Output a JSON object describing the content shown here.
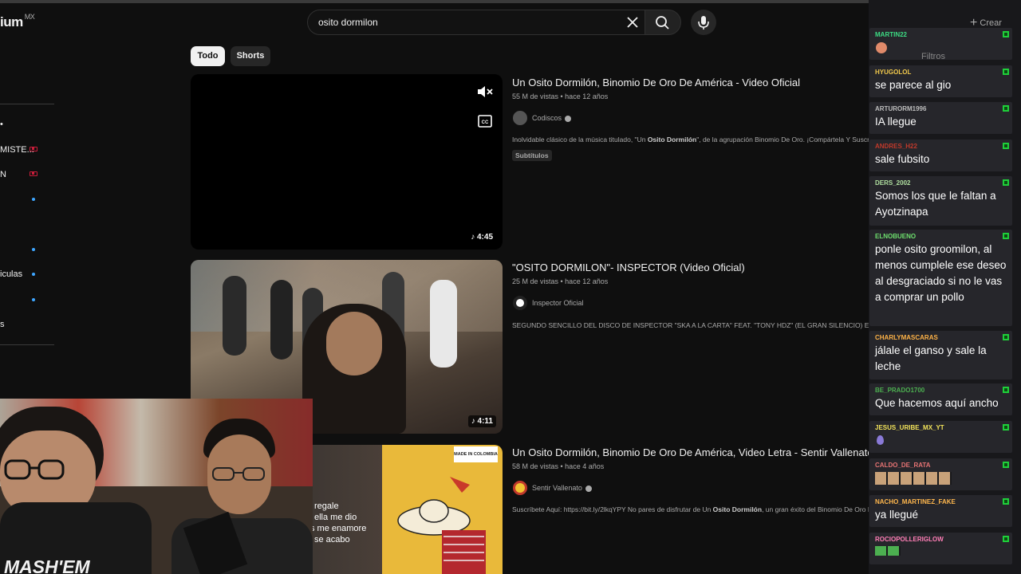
{
  "youtube": {
    "logo_text": "ium",
    "region": "MX",
    "search": {
      "query": "osito dormilon"
    },
    "chips": [
      "Todo",
      "Shorts"
    ],
    "sidebar_items": [
      "MISTE...",
      "N",
      "iculas",
      "s"
    ],
    "create_label": "Crear",
    "filters_label": "Filtros"
  },
  "results": [
    {
      "title": "Un Osito Dormilón, Binomio De Oro De América - Video Oficial",
      "meta": "55 M de vistas • hace 12 años",
      "channel": "Codiscos",
      "desc_prefix": "Inolvidable clásico de la música titulado, \"Un ",
      "desc_bold": "Osito Dormilón",
      "desc_suffix": "\", de la agrupación Binomio De Oro. ¡Compártela Y Suscríbete a ...",
      "badge": "Subtítulos",
      "duration": "4:45"
    },
    {
      "title": "\"OSITO DORMILON\"- INSPECTOR (Video Oficial)",
      "meta": "25 M de vistas • hace 12 años",
      "channel": "Inspector Oficial",
      "desc": "SEGUNDO SENCILLO DEL DISCO DE INSPECTOR \"SKA A LA CARTA\" FEAT. \"TONY HDZ\" (EL GRAN SILENCIO) Escucha a ...",
      "duration": "4:11"
    },
    {
      "title": "Un Osito Dormilón, Binomio De Oro De América, Video Letra - Sentir Vallenato",
      "meta": "58 M de vistas • hace 4 años",
      "channel": "Sentir Vallenato",
      "desc_prefix": "Suscríbete Aquí: https://bit.ly/2lkqYPY No pares de disfrutar de Un ",
      "desc_bold": "Osito Dormilón",
      "desc_suffix": ", un gran éxito del Binomio De Oro De ...",
      "thumb_lyrics": [
        "regale",
        "ella me dio",
        "s me enamore",
        "se acabo"
      ],
      "thumb_badge": "MADE IN COLOMBIA"
    }
  ],
  "webcam_shirt_text": "MASH'EM",
  "chat": [
    {
      "user": "MARTIN22",
      "color": "#3ddc84",
      "text": ""
    },
    {
      "user": "HYUGOLOL",
      "color": "#f2c94c",
      "text": "se parece al gio"
    },
    {
      "user": "ARTURORM1996",
      "color": "#bdbdbd",
      "text": "IA llegue"
    },
    {
      "user": "ANDRES_H22",
      "color": "#c0392b",
      "text": "sale fubsito"
    },
    {
      "user": "DERS_2002",
      "color": "#b0e0a0",
      "text": "Somos los que le faltan a Ayotzinapa"
    },
    {
      "user": "ELNOBUENO",
      "color": "#6ee06e",
      "text": "ponle osito groomilon, al menos cumplele ese deseo al desgraciado si no le vas a comprar un pollo"
    },
    {
      "user": "CHARLYMASCARAS",
      "color": "#ffb347",
      "text": "jálale el ganso y sale la leche"
    },
    {
      "user": "BE_PRADO1700",
      "color": "#4caf50",
      "text": "Que hacemos aquí ancho"
    },
    {
      "user": "JESUS_URIBE_MX_YT",
      "color": "#f2e35a",
      "text": ""
    },
    {
      "user": "CALDO_DE_RATA",
      "color": "#e57373",
      "text": ""
    },
    {
      "user": "NACHO_MARTINEZ_FAKE",
      "color": "#ffb74d",
      "text": "ya llegué"
    },
    {
      "user": "ROCIOPOLLERIGLOW",
      "color": "#ff7eb6",
      "text": ""
    }
  ]
}
